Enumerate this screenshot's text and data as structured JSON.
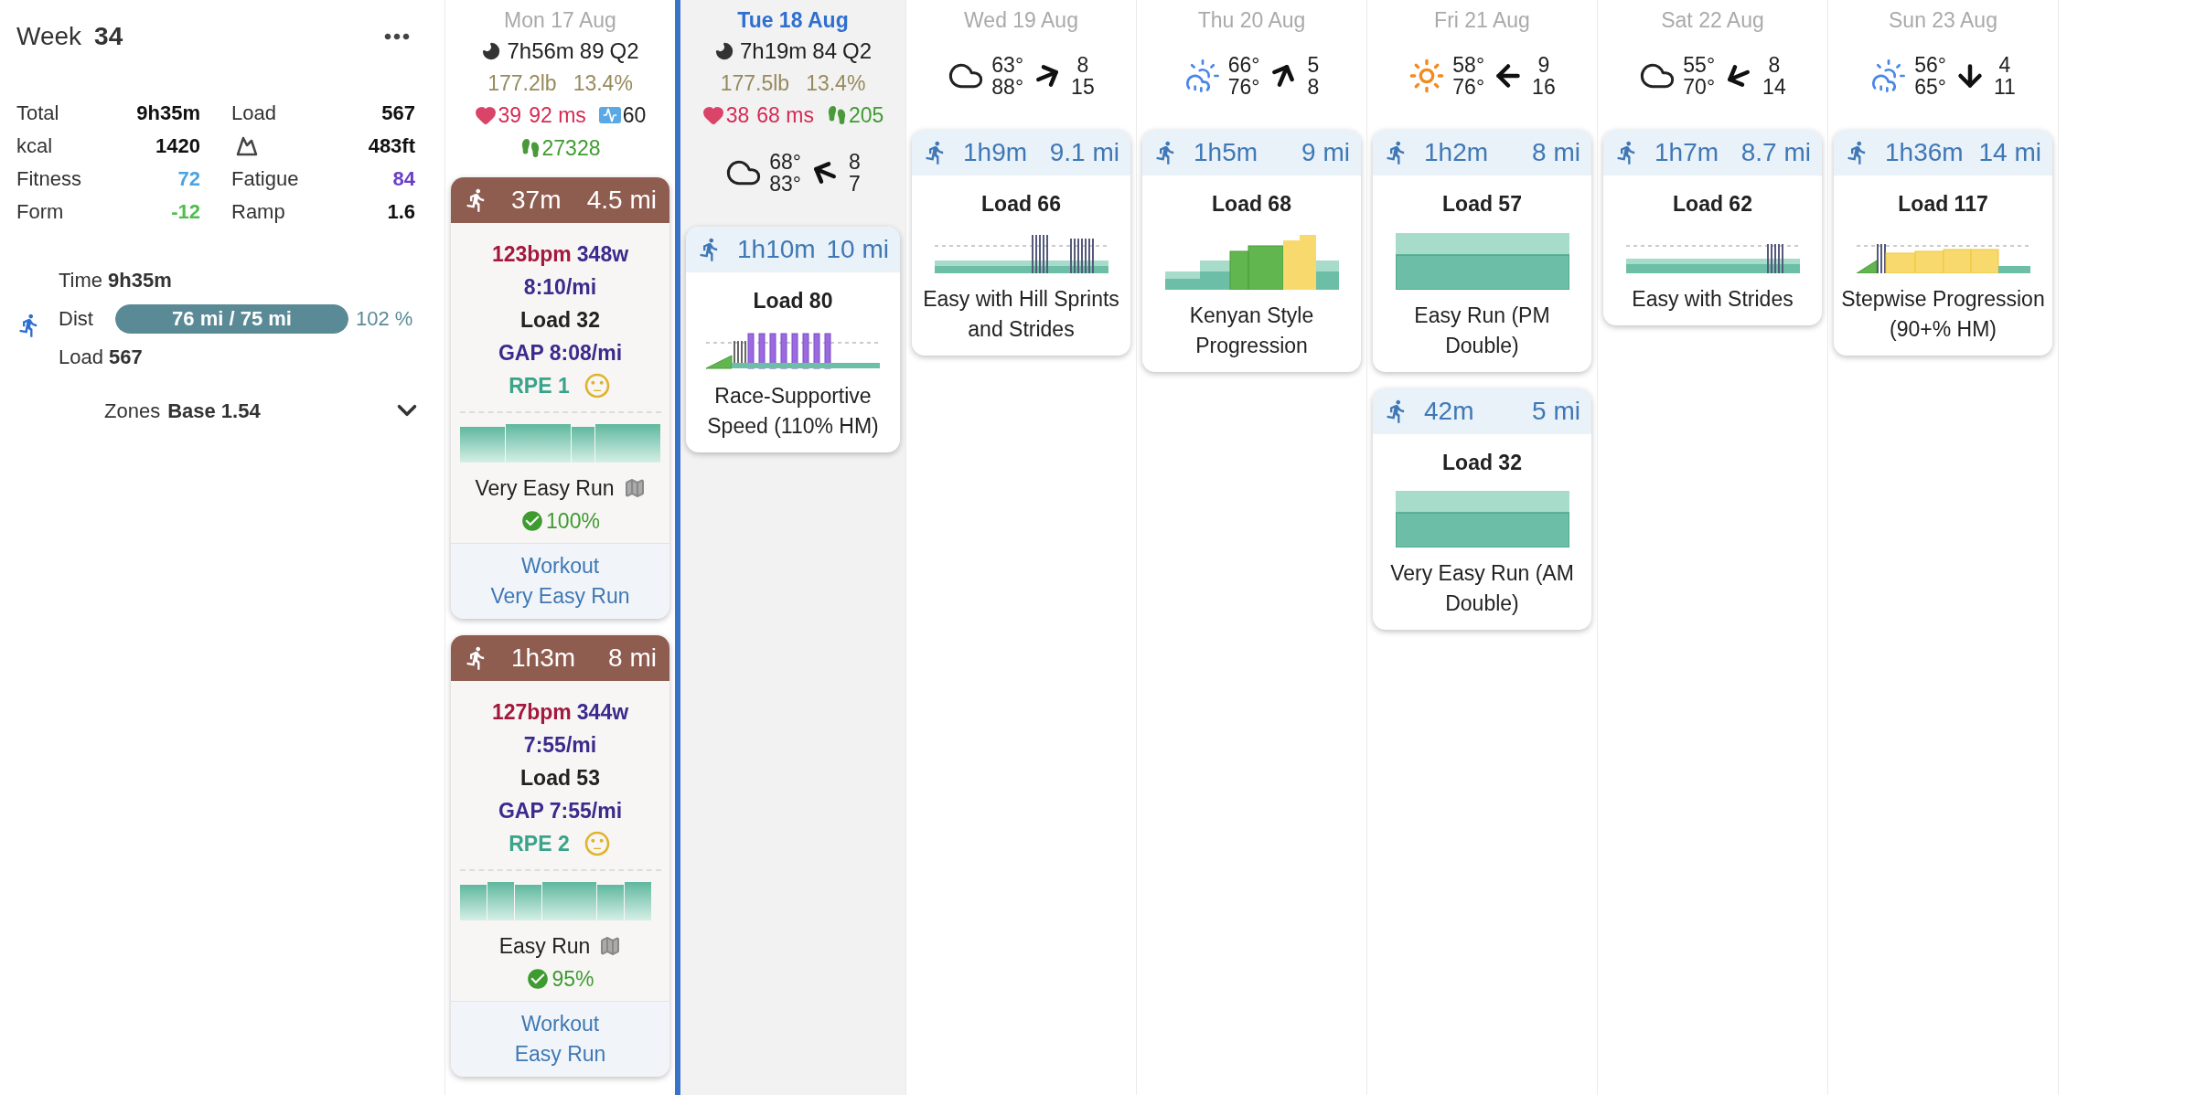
{
  "week": {
    "label": "Week",
    "number": "34",
    "stats": [
      {
        "kind": "text",
        "label": "Total",
        "value": "9h35m",
        "color": "#111111"
      },
      {
        "kind": "text",
        "label": "Load",
        "value": "567",
        "color": "#111111"
      },
      {
        "kind": "text",
        "label": "kcal",
        "value": "1420",
        "color": "#111111"
      },
      {
        "kind": "elevation",
        "value": "483ft",
        "color": "#111111"
      },
      {
        "kind": "text",
        "label": "Fitness",
        "value": "72",
        "color": "#4ba3e3"
      },
      {
        "kind": "text",
        "label": "Fatigue",
        "value": "84",
        "color": "#6a3fc8"
      },
      {
        "kind": "text",
        "label": "Form",
        "value": "-12",
        "color": "#4cbf4c"
      },
      {
        "kind": "text",
        "label": "Ramp",
        "value": "1.6",
        "color": "#111111"
      }
    ],
    "summary": {
      "time_label": "Time",
      "time_value": "9h35m",
      "dist_label": "Dist",
      "progress_text": "76 mi / 75 mi",
      "level": 1,
      "percent": "102 %",
      "load_label": "Load",
      "load_value": "567"
    },
    "zones": {
      "label": "Zones",
      "value": "Base 1.54",
      "expanded": false
    }
  },
  "days": [
    {
      "date": "Mon 17 Aug",
      "selected": false,
      "sleep": {
        "duration": "7h56m",
        "score": "89",
        "quality": "Q2"
      },
      "weight": "177.2lb",
      "body_fat": "13.4%",
      "resting_hr": "39",
      "hrv": "92 ms",
      "respiration": "60",
      "steps": "27328",
      "activities": [
        {
          "kind": "completed",
          "duration": "37m",
          "distance": "4.5 mi",
          "heart_rate": "123bpm",
          "power": "348w",
          "pace": "8:10/mi",
          "load": "Load 32",
          "gap": "GAP 8:08/mi",
          "rpe": "RPE 1",
          "profile": {
            "kind": "zones"
          },
          "name": "Very Easy Run",
          "compliance": "100%",
          "workout_label": "Workout",
          "workout_name": "Very Easy Run"
        },
        {
          "kind": "completed",
          "duration": "1h3m",
          "distance": "8 mi",
          "heart_rate": "127bpm",
          "power": "344w",
          "pace": "7:55/mi",
          "load": "Load 53",
          "gap": "GAP 7:55/mi",
          "rpe": "RPE 2",
          "profile": {
            "kind": "zones"
          },
          "name": "Easy Run",
          "compliance": "95%",
          "workout_label": "Workout",
          "workout_name": "Easy Run"
        }
      ]
    },
    {
      "date": "Tue 18 Aug",
      "selected": true,
      "sleep": {
        "duration": "7h19m",
        "score": "84",
        "quality": "Q2"
      },
      "weight": "177.5lb",
      "body_fat": "13.4%",
      "resting_hr": "38",
      "hrv": "68 ms",
      "steps": "205",
      "weather": {
        "kind": "cloudy",
        "low": "68°",
        "high": "83°",
        "wind_arrow": {
          "kind": "WNW"
        },
        "wind_low": "8",
        "wind_high": "7"
      },
      "activities": [
        {
          "kind": "planned",
          "duration": "1h10m",
          "distance": "10 mi",
          "load": "Load 80",
          "profile": {
            "kind": "intervals"
          },
          "name": "Race-Supportive Speed (110% HM)"
        }
      ]
    },
    {
      "date": "Wed 19 Aug",
      "selected": false,
      "weather": {
        "kind": "cloudy",
        "low": "63°",
        "high": "88°",
        "wind_arrow": {
          "kind": "ENE"
        },
        "wind_low": "8",
        "wind_high": "15"
      },
      "activities": [
        {
          "kind": "planned",
          "duration": "1h9m",
          "distance": "9.1 mi",
          "load": "Load 66",
          "profile": {
            "kind": "hills"
          },
          "name": "Easy with Hill Sprints and Strides"
        }
      ]
    },
    {
      "date": "Thu 20 Aug",
      "selected": false,
      "weather": {
        "kind": "rain",
        "low": "66°",
        "high": "76°",
        "wind_arrow": {
          "kind": "NNE"
        },
        "wind_low": "5",
        "wind_high": "8"
      },
      "activities": [
        {
          "kind": "planned",
          "duration": "1h5m",
          "distance": "9 mi",
          "load": "Load 68",
          "profile": {
            "kind": "progression"
          },
          "name": "Kenyan Style Progression"
        }
      ]
    },
    {
      "date": "Fri 21 Aug",
      "selected": false,
      "weather": {
        "kind": "sunny",
        "low": "58°",
        "high": "76°",
        "wind_arrow": {
          "kind": "W"
        },
        "wind_low": "9",
        "wind_high": "16"
      },
      "activities": [
        {
          "kind": "planned",
          "duration": "1h2m",
          "distance": "8 mi",
          "load": "Load 57",
          "profile": {
            "kind": "steady"
          },
          "name": "Easy Run (PM Double)"
        },
        {
          "kind": "planned",
          "duration": "42m",
          "distance": "5 mi",
          "load": "Load 32",
          "profile": {
            "kind": "steady"
          },
          "name": "Very Easy Run (AM Double)"
        }
      ]
    },
    {
      "date": "Sat 22 Aug",
      "selected": false,
      "weather": {
        "kind": "cloudy",
        "low": "55°",
        "high": "70°",
        "wind_arrow": {
          "kind": "WSW"
        },
        "wind_low": "8",
        "wind_high": "14"
      },
      "activities": [
        {
          "kind": "planned",
          "duration": "1h7m",
          "distance": "8.7 mi",
          "load": "Load 62",
          "profile": {
            "kind": "strides"
          },
          "name": "Easy with Strides"
        }
      ]
    },
    {
      "date": "Sun 23 Aug",
      "selected": false,
      "weather": {
        "kind": "rain",
        "low": "56°",
        "high": "65°",
        "wind_arrow": {
          "kind": "S"
        },
        "wind_low": "4",
        "wind_high": "11"
      },
      "activities": [
        {
          "kind": "planned",
          "duration": "1h36m",
          "distance": "14 mi",
          "load": "Load 117",
          "profile": {
            "kind": "stepwise"
          },
          "name": "Stepwise Progression (90+% HM)"
        }
      ]
    }
  ]
}
